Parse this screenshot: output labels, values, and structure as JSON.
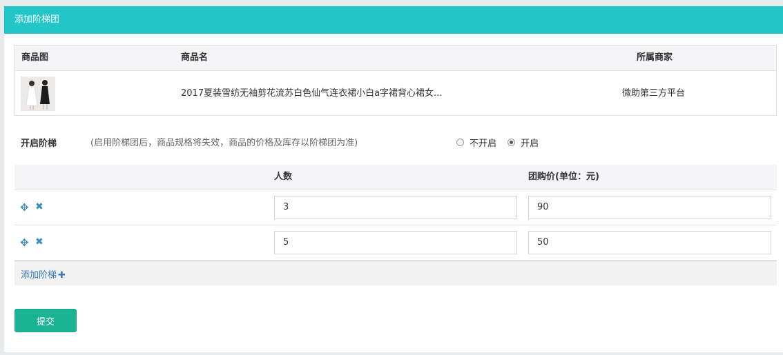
{
  "header": {
    "title": "添加阶梯团"
  },
  "product_table": {
    "columns": {
      "image": "商品图",
      "name": "商品名",
      "merchant": "所属商家"
    },
    "row": {
      "name": "2017夏装雪纺无袖剪花流苏白色仙气连衣裙小白a字裙背心裙女...",
      "merchant": "微助第三方平台"
    }
  },
  "ladder_toggle": {
    "label": "开启阶梯",
    "hint": "(启用阶梯团后，商品规格将失效，商品的价格及库存以阶梯团为准)",
    "options": [
      {
        "label": "不开启",
        "selected": false
      },
      {
        "label": "开启",
        "selected": true
      }
    ]
  },
  "ladder_table": {
    "columns": {
      "count": "人数",
      "price": "团购价(单位：元)"
    },
    "rows": [
      {
        "count": "3",
        "price": "90"
      },
      {
        "count": "5",
        "price": "50"
      }
    ],
    "add_label": "添加阶梯"
  },
  "submit_label": "提交",
  "colors": {
    "header": "#23c6c8",
    "submit": "#1ab394",
    "link": "#337ab7"
  }
}
